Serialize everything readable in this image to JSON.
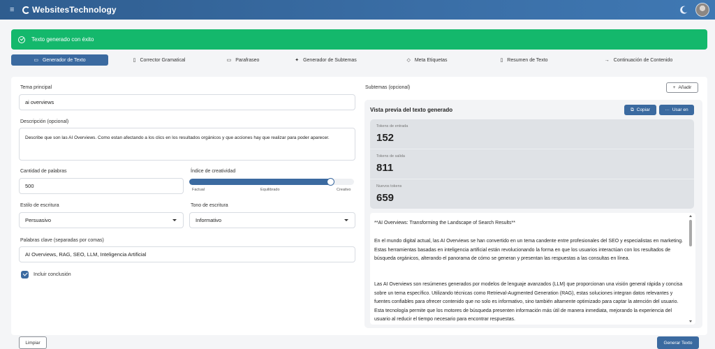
{
  "app": {
    "title": "WebsitesTechnology"
  },
  "alert": {
    "message": "Texto generado con éxito"
  },
  "tabs": [
    {
      "label": "Generador de Texto",
      "icon": "book-icon"
    },
    {
      "label": "Corrector Gramatical",
      "icon": "doc-icon"
    },
    {
      "label": "Parafraseo",
      "icon": "chat-icon"
    },
    {
      "label": "Generador de Subtemas",
      "icon": "sparkle-icon"
    },
    {
      "label": "Meta Etiquetas",
      "icon": "tag-icon"
    },
    {
      "label": "Resumen de Texto",
      "icon": "bookmark-icon"
    },
    {
      "label": "Continuación de Contenido",
      "icon": "arrow-right-icon"
    }
  ],
  "form": {
    "topic_label": "Tema principal",
    "topic_value": "ai overviews",
    "description_label": "Descripción (opcional)",
    "description_value": "Describe que son las AI Overviews. Como estan afectando a los clics en los resultados orgánicos y que acciones hay que realizar para poder aparecer.",
    "word_count_label": "Cantidad de palabras",
    "word_count_value": "500",
    "creativity_label": "Índice de creatividad",
    "creativity_value": 0.86,
    "creativity_ticks": [
      "Factual",
      "Equilibrado",
      "Creativo"
    ],
    "style_label": "Estilo de escritura",
    "style_value": "Persuasivo",
    "tone_label": "Tono de escritura",
    "tone_value": "Informativo",
    "keywords_label": "Palabras clave (separadas por comas)",
    "keywords_value": "AI Overviews, RAG, SEO, LLM, Inteligencia Artificial",
    "include_conclusion_label": "Incluir conclusión",
    "include_conclusion_checked": true,
    "clear_button": "Limpiar",
    "generate_button": "Generar Texto"
  },
  "subtopics": {
    "label": "Subtemas (opcional)",
    "add_button": "Añadir"
  },
  "preview": {
    "title": "Vista previa del texto generado",
    "copy_button": "Copiar",
    "use_button": "Usar en",
    "stats": [
      {
        "label": "Tokens de entrada",
        "value": "152"
      },
      {
        "label": "Tokens de salida",
        "value": "811"
      },
      {
        "label": "Nuevos tokens",
        "value": "659"
      }
    ],
    "paragraphs": [
      "**AI Overviews: Transforming the Landscape of Search Results**",
      "En el mundo digital actual, las AI Overviews se han convertido en un tema candente entre profesionales del SEO y especialistas en marketing. Estas herramientas basadas en inteligencia artificial están revolucionando la forma en que los usuarios interactúan con los resultados de búsqueda orgánicos, alterando el panorama de cómo se generan y presentan las respuestas a las consultas en línea.",
      "Las AI Overviews son resúmenes generados por modelos de lenguaje avanzados (LLM) que proporcionan una visión general rápida y concisa sobre un tema específico. Utilizando técnicas como Retrieval-Augmented Generation (RAG), estas soluciones integran datos relevantes y fuentes confiables para ofrecer contenido que no solo es informativo, sino también altamente optimizado para captar la atención del usuario. Esta tecnología permite que los motores de búsqueda presenten información más útil de manera inmediata, mejorando la experiencia del usuario al reducir el tiempo necesario para encontrar respuestas."
    ]
  },
  "colors": {
    "header": "#3a6ea6",
    "accent": "#3b6aa0",
    "success": "#14b86c"
  }
}
